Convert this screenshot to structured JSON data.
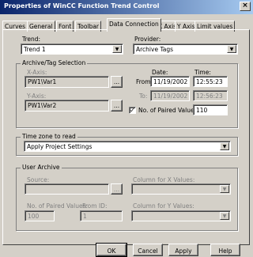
{
  "window": {
    "title": "Properties of WinCC Function Trend Control",
    "close_glyph": "×"
  },
  "tabs": [
    {
      "label": "Curves"
    },
    {
      "label": "General"
    },
    {
      "label": "Font"
    },
    {
      "label": "Toolbar"
    },
    {
      "label": "Data Connection"
    },
    {
      "label": "X Axis"
    },
    {
      "label": "Y Axis"
    },
    {
      "label": "Limit values"
    }
  ],
  "active_tab": "Data Connection",
  "trend": {
    "label": "Trend:",
    "value": "Trend 1"
  },
  "provider": {
    "label": "Provider:",
    "value": "Archive Tags"
  },
  "archive_tag_selection": {
    "title": "Archive/Tag Selection",
    "x_axis": {
      "label": "X-Axis:",
      "value": "PW1\\Var1",
      "browse": "..."
    },
    "y_axis": {
      "label": "Y-Axis:",
      "value": "PW1\\Var2",
      "browse": "..."
    },
    "date_header": "Date:",
    "time_header": "Time:",
    "from": {
      "label": "From:",
      "date": "11/19/2002",
      "time": "12:55:23"
    },
    "to": {
      "label": "To:",
      "date": "11/19/2002",
      "time": "12:56:23"
    },
    "paired_values": {
      "label": "No. of Paired Values:",
      "checked": true,
      "value": "110"
    }
  },
  "time_zone": {
    "title": "Time zone to read",
    "value": "Apply Project Settings"
  },
  "user_archive": {
    "title": "User Archive",
    "source_label": "Source:",
    "browse": "...",
    "column_x_label": "Column for X Values:",
    "column_y_label": "Column for Y Values:",
    "paired_label": "No. of Paired Values:",
    "paired_value": "100",
    "from_id_label": "From ID:",
    "from_id_value": "1"
  },
  "buttons": {
    "ok": "OK",
    "cancel": "Cancel",
    "apply": "Apply",
    "help": "Help"
  }
}
